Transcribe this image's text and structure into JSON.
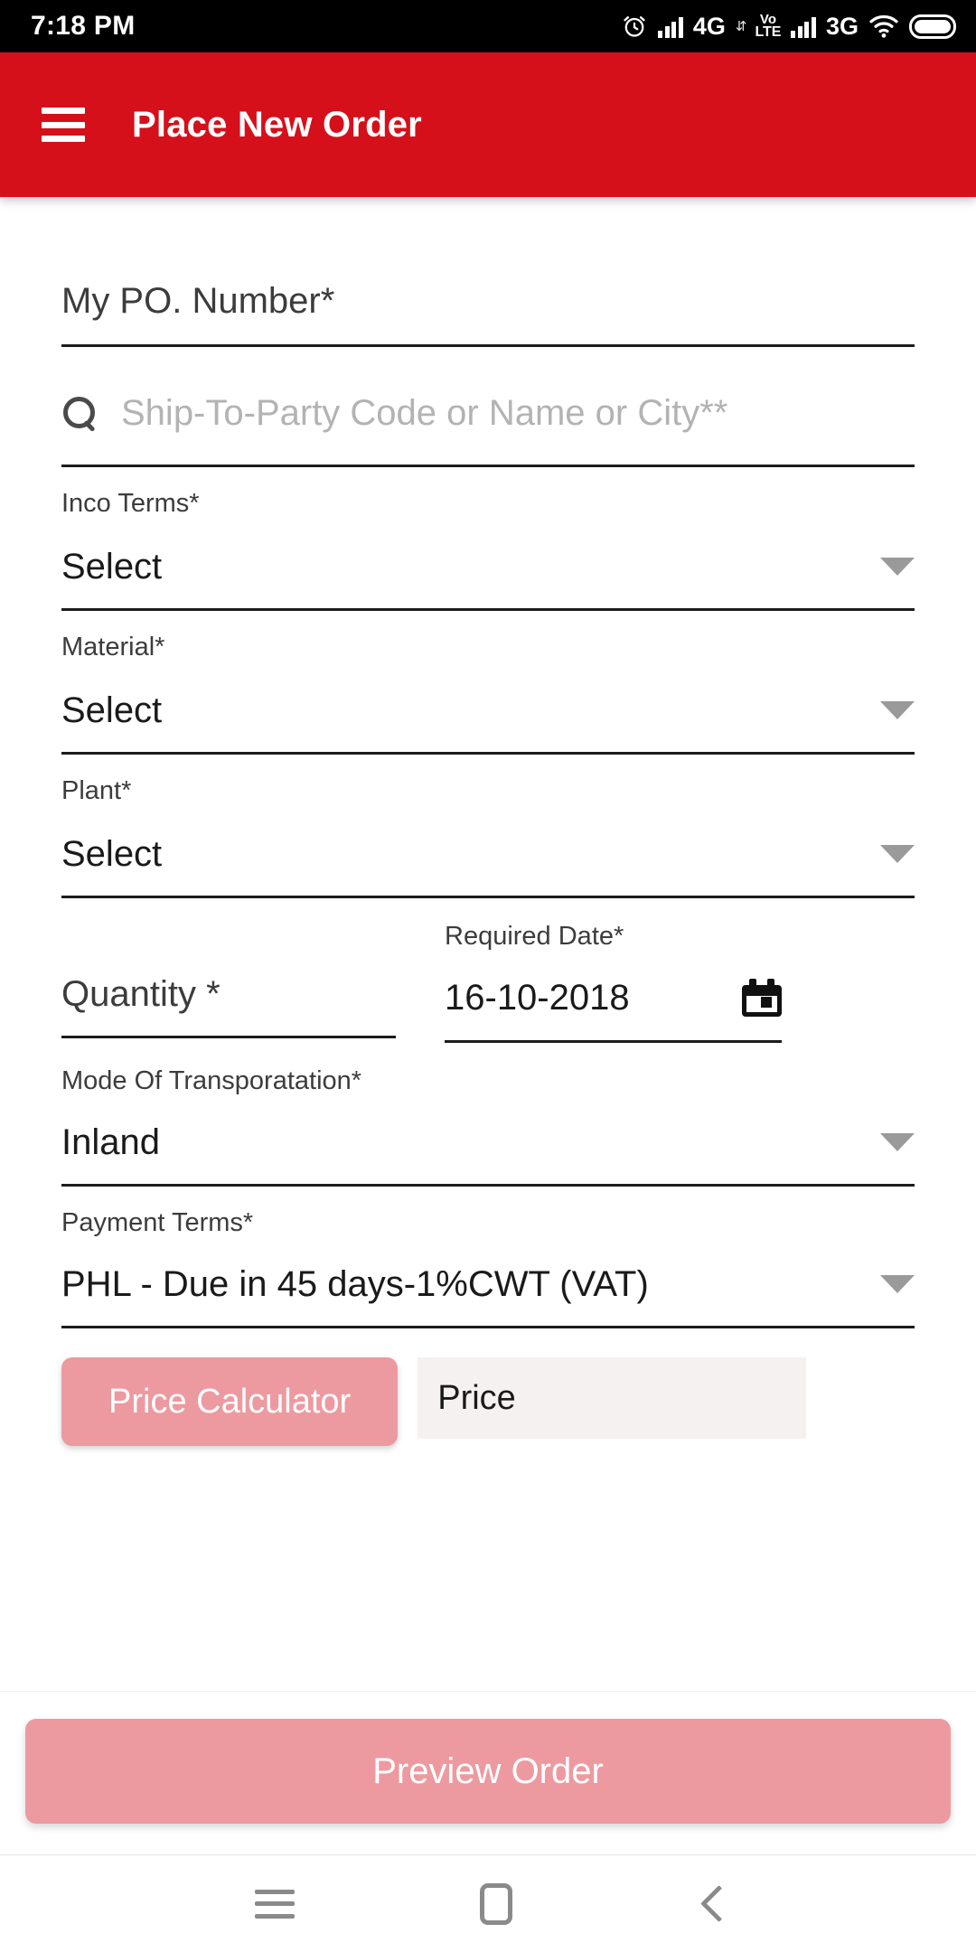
{
  "status_bar": {
    "time": "7:18 PM",
    "icons": [
      "alarm-clock-icon",
      "signal-bars-icon",
      "4g-label",
      "data-transfer-icon",
      "volte-icon",
      "signal-bars-icon",
      "3g-label",
      "wifi-icon",
      "battery-icon"
    ],
    "network_primary": "4G",
    "network_secondary": "3G",
    "volte_top": "Vo",
    "volte_bottom": "LTE"
  },
  "app_bar": {
    "title": "Place New Order",
    "menu_icon": "hamburger-menu-icon",
    "background_color": "#D5101B",
    "text_color": "#FFFFFF"
  },
  "form": {
    "po_number": {
      "placeholder": "My PO. Number*"
    },
    "ship_to_party": {
      "placeholder": "Ship-To-Party Code or Name or City**",
      "icon": "search-icon"
    },
    "inco_terms": {
      "label": "Inco Terms*",
      "value": "Select"
    },
    "material": {
      "label": "Material*",
      "value": "Select"
    },
    "plant": {
      "label": "Plant*",
      "value": "Select"
    },
    "quantity": {
      "placeholder": "Quantity *"
    },
    "required_date": {
      "label": "Required Date*",
      "value": "16-10-2018",
      "icon": "calendar-icon"
    },
    "mode_of_transportation": {
      "label": "Mode Of Transporatation*",
      "value": "Inland"
    },
    "payment_terms": {
      "label": "Payment Terms*",
      "value": "PHL - Due in 45 days-1%CWT (VAT)"
    },
    "price_calculator_button": "Price Calculator",
    "price_field": {
      "placeholder": "Price"
    }
  },
  "footer": {
    "preview_button": "Preview Order",
    "button_color": "#EC9AA0"
  },
  "nav_bar": {
    "recents": "recents-icon",
    "home": "home-icon",
    "back": "back-icon"
  }
}
